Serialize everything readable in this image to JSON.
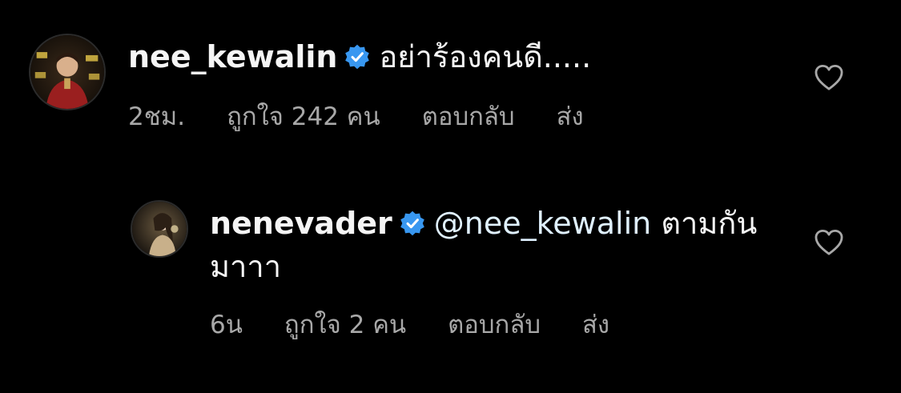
{
  "colors": {
    "background": "#000000",
    "primary_text": "#f5f5f5",
    "secondary_text": "#a8a8a8",
    "verified_badge": "#3897f0",
    "mention": "#e0f1ff"
  },
  "comments": [
    {
      "avatar_icon": "profile-photo",
      "username": "nee_kewalin",
      "verified": true,
      "text": "อย่าร้องคนดี.....",
      "time": "2ชม.",
      "likes": "ถูกใจ 242 คน",
      "reply_label": "ตอบกลับ",
      "send_label": "ส่ง",
      "like_icon": "heart-outline-icon"
    },
    {
      "avatar_icon": "profile-photo",
      "username": "nenevader",
      "verified": true,
      "mention": "@nee_kewalin",
      "text_inline": "ตามกัน",
      "text_continued": "มาาา",
      "time": "6น",
      "likes": "ถูกใจ 2 คน",
      "reply_label": "ตอบกลับ",
      "send_label": "ส่ง",
      "like_icon": "heart-outline-icon"
    }
  ]
}
